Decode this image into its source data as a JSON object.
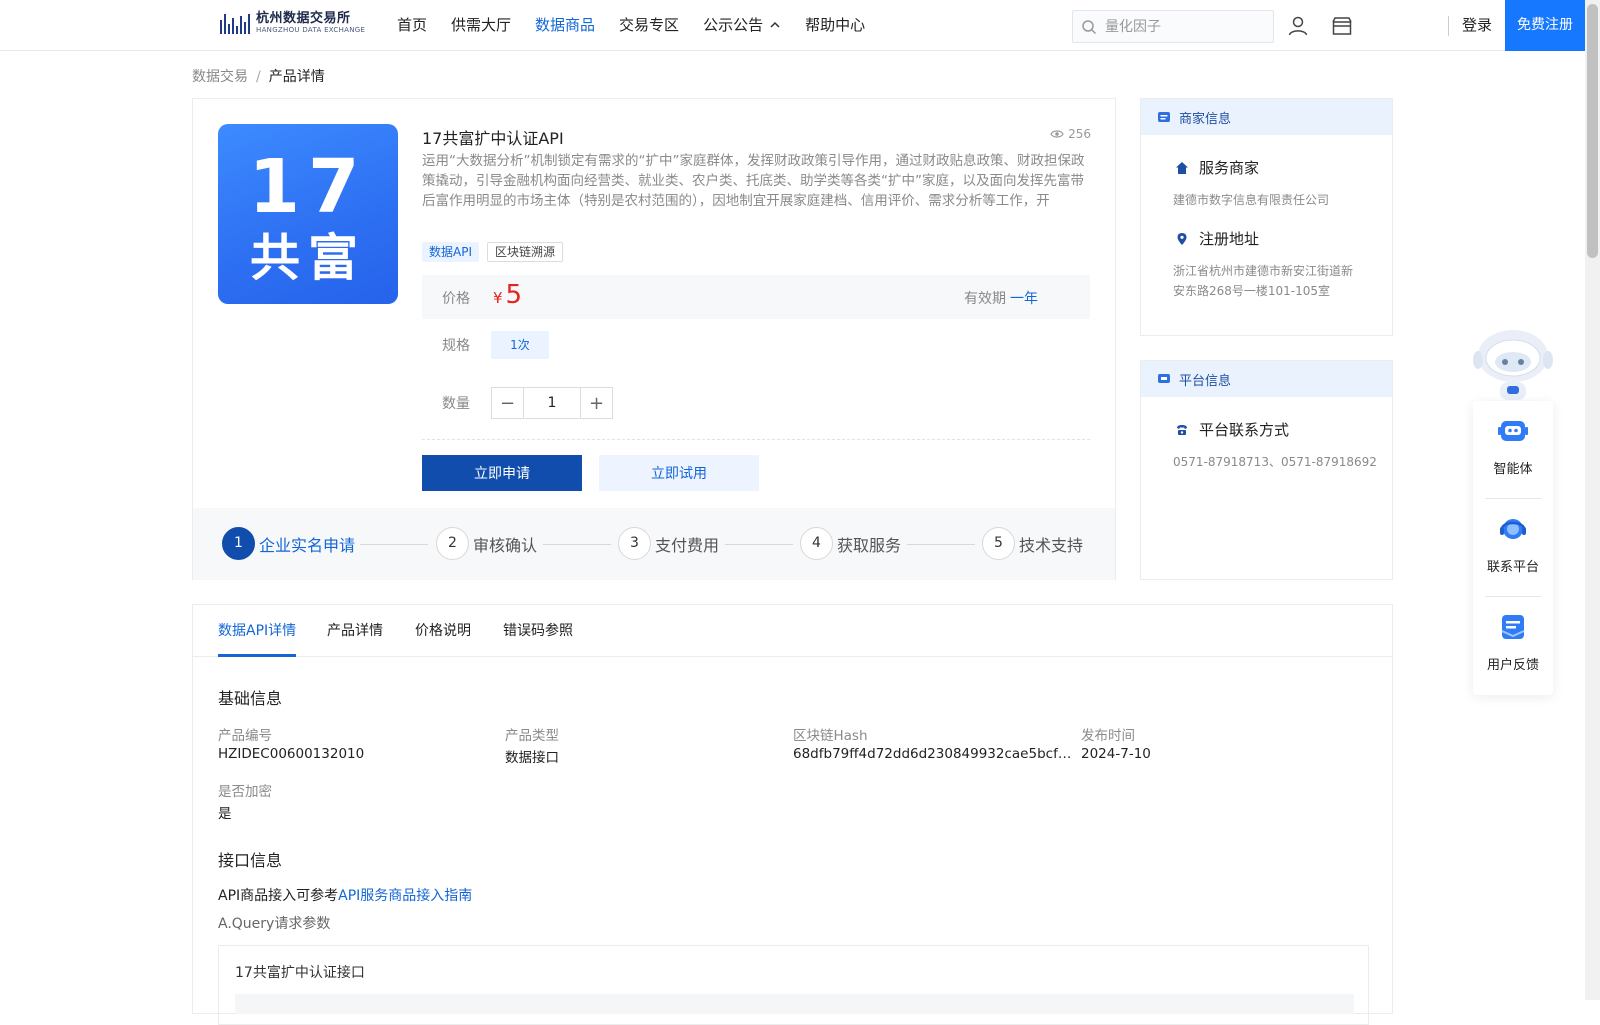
{
  "header": {
    "logo_cn": "杭州数据交易所",
    "logo_en": "HANGZHOU DATA EXCHANGE",
    "nav": [
      {
        "label": "首页"
      },
      {
        "label": "供需大厅"
      },
      {
        "label": "数据商品"
      },
      {
        "label": "交易专区"
      },
      {
        "label": "公示公告"
      },
      {
        "label": "帮助中心"
      }
    ],
    "active_nav": "数据商品",
    "search_placeholder": "量化因子",
    "login": "登录",
    "register": "免费注册"
  },
  "breadcrumb": {
    "parent": "数据交易",
    "separator": "/",
    "current": "产品详情"
  },
  "product": {
    "cover_number": "17",
    "cover_word": "共富",
    "title": "17共富扩中认证API",
    "views": "256",
    "description": "运用“大数据分析”机制锁定有需求的“扩中”家庭群体，发挥财政政策引导作用，通过财政贴息政策、财政担保政策撬动，引导金融机构面向经营类、就业类、农户类、托底类、助学类等各类“扩中”家庭，以及面向发挥先富带后富作用明显的市场主体（特别是农村范围的），因地制宜开展家庭建档、信用评价、需求分析等工作，开",
    "tags": [
      "数据API",
      "区块链溯源"
    ],
    "price_label": "价格",
    "currency": "¥",
    "price": "5",
    "validity_label": "有效期",
    "validity_value": "一年",
    "spec_label": "规格",
    "spec_value": "1次",
    "qty_label": "数量",
    "qty_minus": "−",
    "qty_value": "1",
    "qty_plus": "+",
    "apply_button": "立即申请",
    "trial_button": "立即试用"
  },
  "steps": [
    {
      "num": "1",
      "label": "企业实名申请"
    },
    {
      "num": "2",
      "label": "审核确认"
    },
    {
      "num": "3",
      "label": "支付费用"
    },
    {
      "num": "4",
      "label": "获取服务"
    },
    {
      "num": "5",
      "label": "技术支持"
    }
  ],
  "merchant": {
    "header": "商家信息",
    "service_title": "服务商家",
    "service_value": "建德市数字信息有限责任公司",
    "address_title": "注册地址",
    "address_value": "浙江省杭州市建德市新安江街道新安东路268号一楼101-105室"
  },
  "platform": {
    "header": "平台信息",
    "contact_title": "平台联系方式",
    "contact_value": "0571-87918713、0571-87918692"
  },
  "float_widget": [
    {
      "label": "智能体",
      "icon": "robot-icon"
    },
    {
      "label": "联系平台",
      "icon": "headset-icon"
    },
    {
      "label": "用户反馈",
      "icon": "feedback-icon"
    }
  ],
  "details": {
    "tabs": [
      "数据API详情",
      "产品详情",
      "价格说明",
      "错误码参照"
    ],
    "basic_title": "基础信息",
    "fields": [
      {
        "label": "产品编号",
        "value": "HZIDEC00600132010"
      },
      {
        "label": "产品类型",
        "value": "数据接口"
      },
      {
        "label": "区块链Hash",
        "value": "68dfb79ff4d72dd6d230849932cae5bcfb6a..."
      },
      {
        "label": "发布时间",
        "value": "2024-7-10"
      },
      {
        "label": "是否加密",
        "value": "是"
      }
    ],
    "interface_title": "接口信息",
    "api_prefix": "API商品接入可参考",
    "api_link": "API服务商品接入指南",
    "query_label": "A.Query请求参数",
    "sub_title": "17共富扩中认证接口"
  },
  "colors": {
    "primary": "#1366d6",
    "button_dark": "#114dac",
    "register_bg": "#1677ff",
    "price": "#e8221e"
  }
}
